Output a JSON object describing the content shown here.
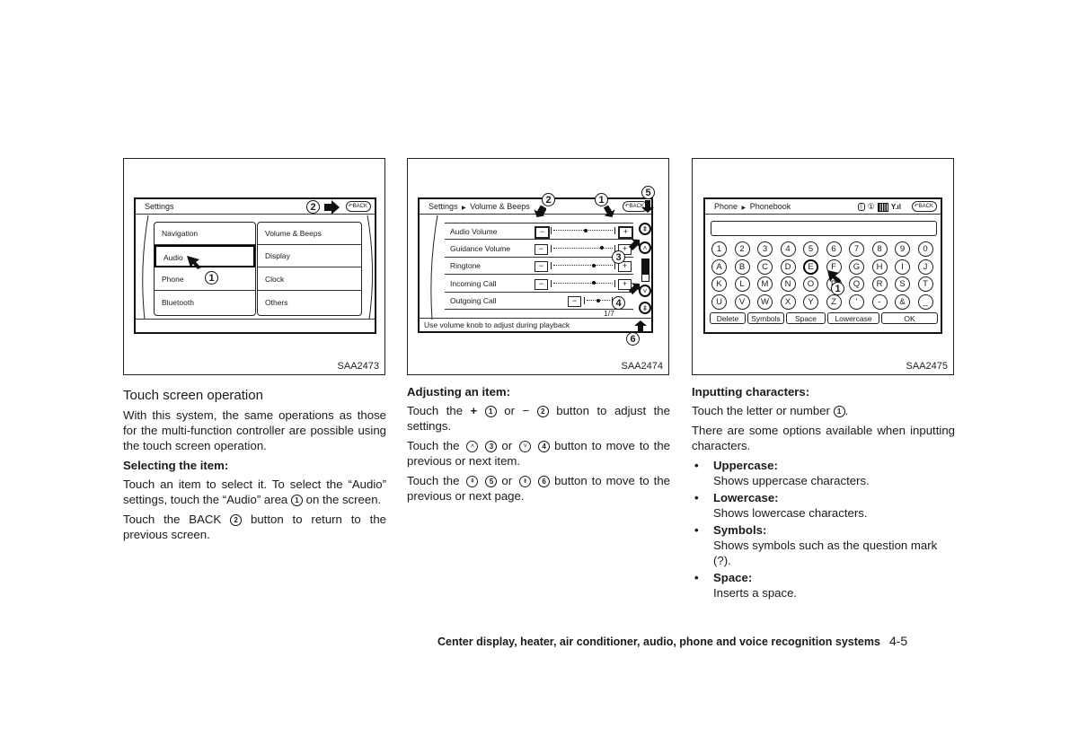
{
  "figures": [
    {
      "code": "SAA2473",
      "header": "Settings",
      "back_label": "BACK",
      "left_items": [
        "Navigation",
        "Audio",
        "Phone",
        "Bluetooth"
      ],
      "right_items": [
        "Volume & Beeps",
        "Display",
        "Clock",
        "Others"
      ],
      "selected_item": "Audio",
      "callouts": [
        "1",
        "2"
      ]
    },
    {
      "code": "SAA2474",
      "header_parent": "Settings",
      "header_child": "Volume & Beeps",
      "back_label": "BACK",
      "rows": [
        {
          "label": "Audio Volume",
          "level": 0.55
        },
        {
          "label": "Guidance Volume",
          "level": 0.82
        },
        {
          "label": "Ringtone",
          "level": 0.68
        },
        {
          "label": "Incoming Call",
          "level": 0.68
        },
        {
          "label": "Outgoing Call",
          "level": 0.5
        }
      ],
      "page_indicator": "1/7",
      "footer": "Use volume knob to adjust during playback",
      "callouts": [
        "1",
        "2",
        "3",
        "4",
        "5",
        "6"
      ],
      "minus_glyph": "−",
      "plus_glyph": "+",
      "page_up_glyph": "⇞",
      "item_up_glyph": "˄",
      "item_down_glyph": "˅",
      "page_down_glyph": "⇟"
    },
    {
      "code": "SAA2475",
      "header_parent": "Phone",
      "header_child": "Phonebook",
      "back_label": "BACK",
      "status_icons": [
        "bluetooth-icon",
        "phone-1-icon",
        "battery-icon",
        "signal-icon"
      ],
      "input_value": "",
      "keys": [
        [
          "1",
          "2",
          "3",
          "4",
          "5",
          "6",
          "7",
          "8",
          "9",
          "0"
        ],
        [
          "A",
          "B",
          "C",
          "D",
          "E",
          "F",
          "G",
          "H",
          "I",
          "J"
        ],
        [
          "K",
          "L",
          "M",
          "N",
          "O",
          "P",
          "Q",
          "R",
          "S",
          "T"
        ],
        [
          "U",
          "V",
          "W",
          "X",
          "Y",
          "Z",
          "'",
          "-",
          "&",
          "_"
        ]
      ],
      "highlighted_key": "E",
      "function_keys": [
        "Delete",
        "Symbols",
        "Space",
        "Lowercase",
        "OK"
      ],
      "callouts": [
        "1"
      ]
    }
  ],
  "col1": {
    "title": "Touch screen operation",
    "intro": "With this system, the same operations as those for the multi-function controller are possible using the touch screen operation.",
    "heading": "Selecting the item:",
    "p1_a": "Touch an item to select it. To select the “Audio” settings, touch the “Audio” area",
    "p1_num": "1",
    "p1_b": "on the screen.",
    "p2_a": "Touch the BACK",
    "p2_num": "2",
    "p2_b": "button to return to the previous screen."
  },
  "col2": {
    "heading": "Adjusting an item:",
    "p1_a": "Touch the",
    "p1_plus": "+",
    "p1_n1": "1",
    "p1_or": "or",
    "p1_minus": "−",
    "p1_n2": "2",
    "p1_b": "button to adjust the settings.",
    "p2_a": "Touch the",
    "p2_n1": "3",
    "p2_or": "or",
    "p2_n2": "4",
    "p2_b": "button to move to the previous or next item.",
    "p3_a": "Touch the",
    "p3_n1": "5",
    "p3_or": "or",
    "p3_n2": "6",
    "p3_b": "button to move to the previous or next page."
  },
  "col3": {
    "heading": "Inputting characters:",
    "p1_a": "Touch the letter or number",
    "p1_num": "1",
    "p1_b": ".",
    "p2": "There are some options available when inputting characters.",
    "bullets": [
      {
        "title": "Uppercase:",
        "desc": "Shows uppercase characters."
      },
      {
        "title": "Lowercase:",
        "desc": "Shows lowercase characters."
      },
      {
        "title": "Symbols:",
        "desc": "Shows symbols such as the question mark (?)."
      },
      {
        "title": "Space:",
        "desc": "Inserts a space."
      }
    ]
  },
  "footer": {
    "section": "Center display, heater, air conditioner, audio, phone and voice recognition systems",
    "page": "4-5"
  }
}
